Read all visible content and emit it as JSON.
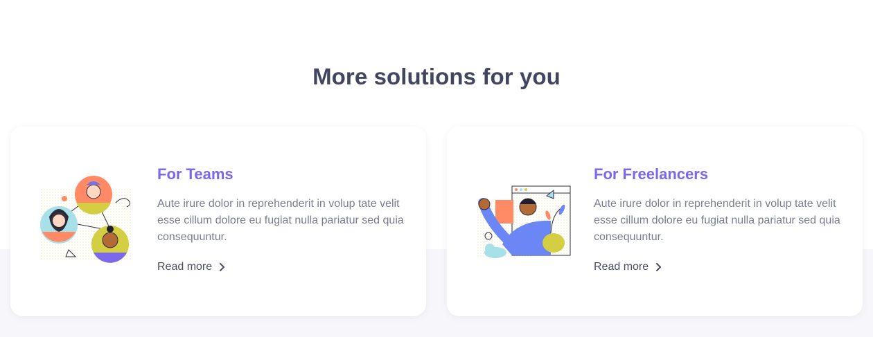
{
  "section": {
    "title": "More solutions for you"
  },
  "cards": [
    {
      "title": "For Teams",
      "description": "Aute irure dolor in reprehenderit in volup tate velit esse cillum dolore eu fugiat nulla pariatur sed quia consequuntur.",
      "link": "Read more",
      "illustration": "team-people-illustration"
    },
    {
      "title": "For Freelancers",
      "description": "Aute irure dolor in reprehenderit in volup tate velit esse cillum dolore eu fugiat nulla pariatur sed quia consequuntur.",
      "link": "Read more",
      "illustration": "freelancer-waving-illustration"
    }
  ],
  "colors": {
    "accent": "#7b68ee",
    "heading": "#434560",
    "body_text": "#7a7d92",
    "background_band": "#f7f7fb"
  }
}
